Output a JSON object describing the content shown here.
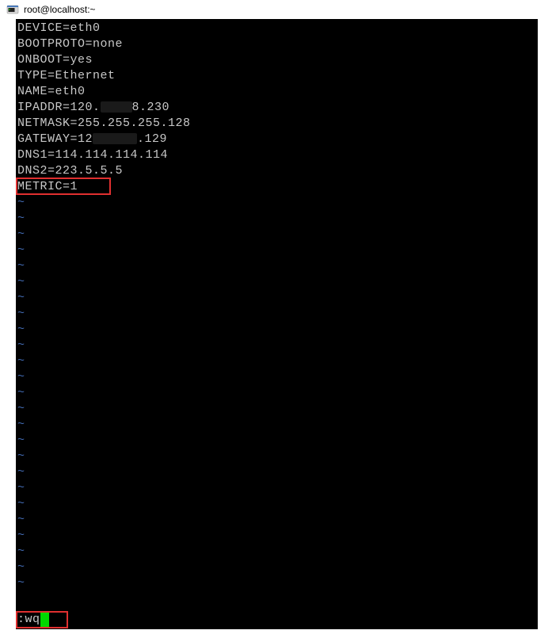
{
  "window": {
    "title": "root@localhost:~"
  },
  "file": {
    "lines": [
      "DEVICE=eth0",
      "BOOTPROTO=none",
      "ONBOOT=yes",
      "TYPE=Ethernet",
      "NAME=eth0"
    ],
    "ipaddr_prefix": "IPADDR=120.",
    "ipaddr_suffix": "8.230",
    "netmask": "NETMASK=255.255.255.128",
    "gateway_prefix": "GATEWAY=12",
    "gateway_suffix": ".129",
    "dns1": "DNS1=114.114.114.114",
    "dns2": "DNS2=223.5.5.5",
    "metric": "METRIC=1"
  },
  "tilde_char": "~",
  "command": ":wq"
}
